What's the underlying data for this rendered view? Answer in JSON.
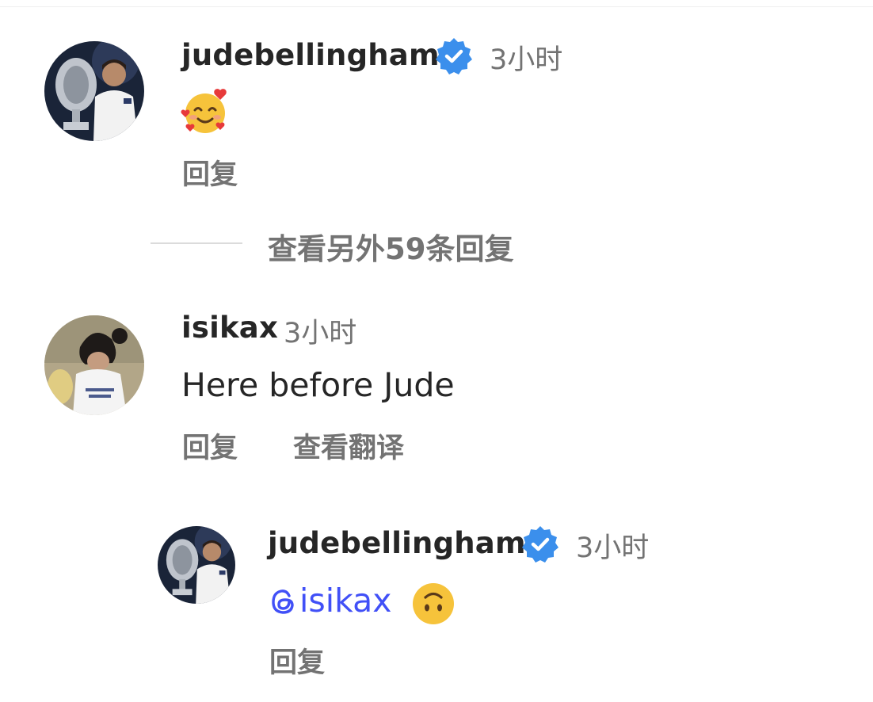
{
  "comments": [
    {
      "username": "judebellingham",
      "verified": true,
      "time": "3小时",
      "emoji": "smiling-face-with-hearts",
      "reply_label": "回复"
    },
    {
      "username": "isikax",
      "verified": false,
      "time": "3小时",
      "text": "Here before Jude",
      "reply_label": "回复",
      "translate_label": "查看翻译"
    }
  ],
  "view_replies_label": "查看另外59条回复",
  "reply": {
    "username": "judebellingham",
    "verified": true,
    "time": "3小时",
    "mention": "isikax",
    "emoji": "upside-down-face",
    "reply_label": "回复"
  },
  "colors": {
    "text": "#262626",
    "secondary": "#737373",
    "mention": "#4150f7",
    "verified": "#3b8fec"
  }
}
